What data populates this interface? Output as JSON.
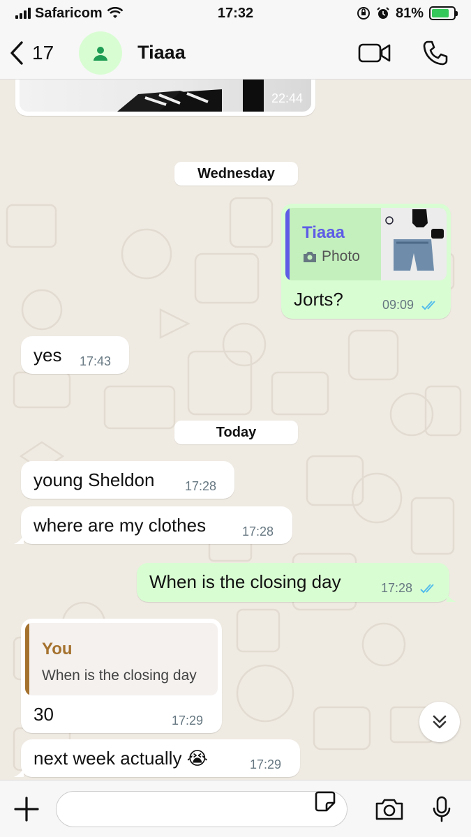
{
  "status_bar": {
    "carrier": "Safaricom",
    "time": "17:32",
    "battery_percent": "81%",
    "battery_level": 0.81
  },
  "header": {
    "back_count": "17",
    "contact_name": "Tiaaa",
    "icons": [
      "back-chevron-icon",
      "person-icon",
      "video-call-icon",
      "phone-icon"
    ]
  },
  "chat": {
    "image_message_time": "22:44",
    "day_separators": [
      "Wednesday",
      "Today"
    ],
    "reply_message": {
      "quoted_author": "Tiaaa",
      "quoted_type": "Photo",
      "text": "Jorts?",
      "time": "09:09"
    },
    "messages": [
      {
        "text": "yes",
        "time": "17:43"
      },
      {
        "text": "young Sheldon",
        "time": "17:28"
      },
      {
        "text": "where are my clothes",
        "time": "17:28"
      },
      {
        "text": "When is the closing day",
        "time": "17:28"
      },
      {
        "text": "30",
        "time": "17:29"
      },
      {
        "text": "next week actually 😭",
        "time": "17:29"
      }
    ],
    "quote_you": {
      "author": "You",
      "text": "When is the closing day"
    }
  },
  "colors": {
    "outgoing_bubble": "#d9fdd3",
    "incoming_bubble": "#ffffff",
    "chat_background": "#efeae2",
    "read_ticks": "#53bdeb",
    "quote_purple": "#5e5ce6",
    "quote_brown": "#a5722e"
  },
  "input": {
    "placeholder": ""
  }
}
